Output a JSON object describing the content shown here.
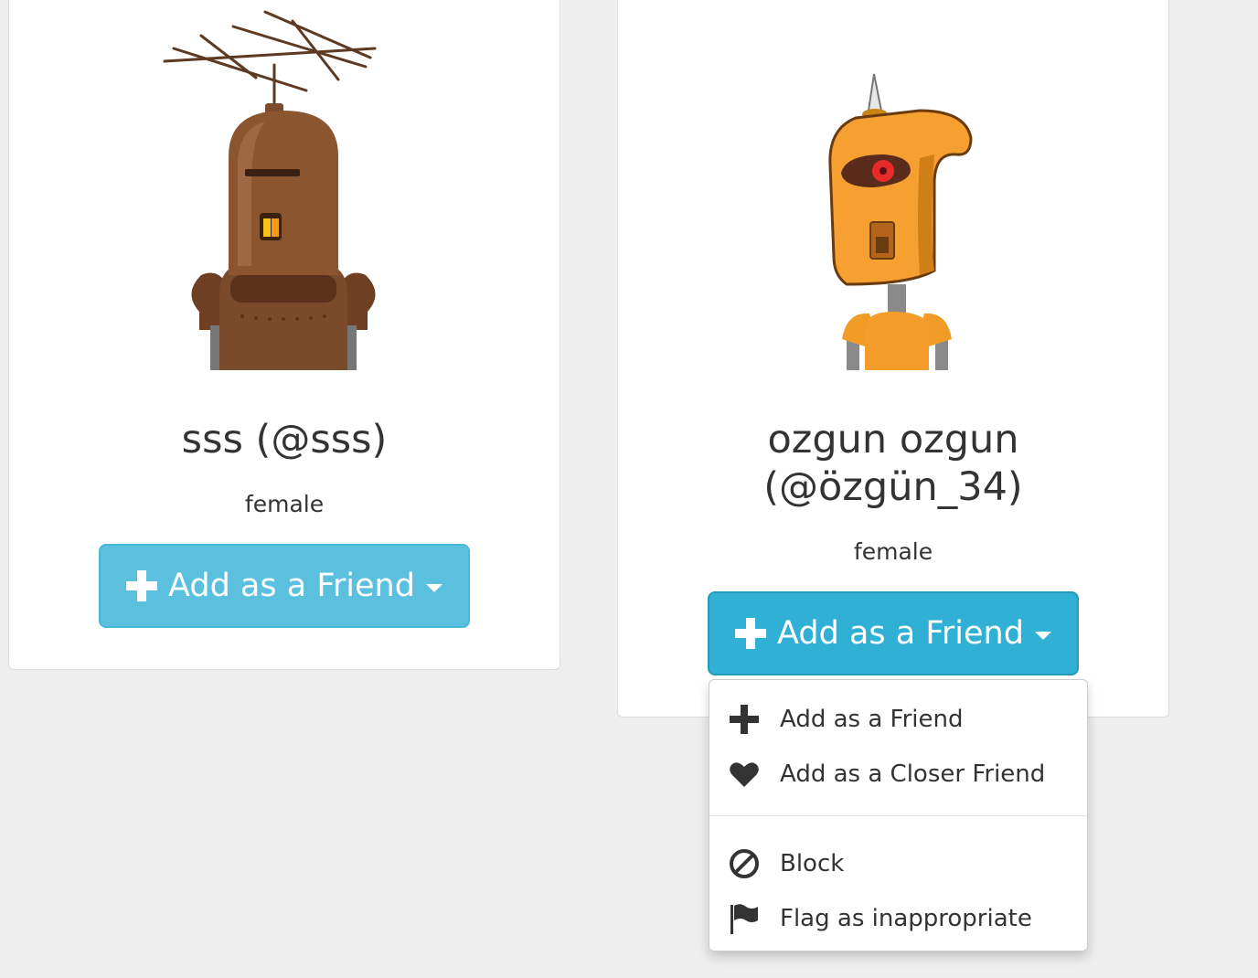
{
  "users": [
    {
      "name_line1": "sss (@sss)",
      "name_line2": "",
      "gender": "female",
      "button_label": "Add as a Friend",
      "avatar": "brown-robot-with-antenna",
      "colors": {
        "button": "#5bc0de"
      }
    },
    {
      "name_line1": "ozgun ozgun",
      "name_line2": "(@özgün_34)",
      "gender": "female",
      "button_label": "Add as a Friend",
      "avatar": "orange-robot-with-horn",
      "colors": {
        "button": "#31b0d5"
      }
    }
  ],
  "dropdown": {
    "open": true,
    "items": [
      {
        "label": "Add as a Friend",
        "icon": "plus-icon"
      },
      {
        "label": "Add as a Closer Friend",
        "icon": "heart-icon"
      },
      {
        "label": "Block",
        "icon": "ban-icon"
      },
      {
        "label": "Flag as inappropriate",
        "icon": "flag-icon"
      }
    ]
  },
  "colors": {
    "background": "#eeeeee",
    "card": "#ffffff",
    "text": "#333333"
  }
}
